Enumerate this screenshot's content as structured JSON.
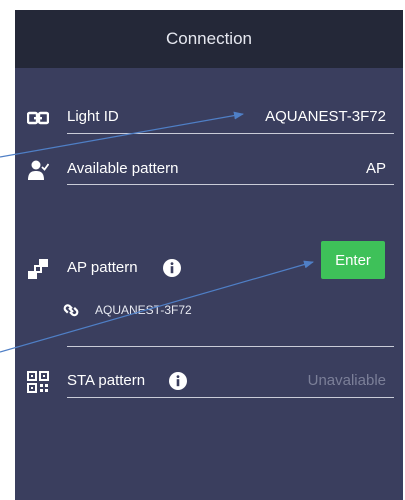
{
  "header": {
    "title": "Connection"
  },
  "rows": {
    "light_id": {
      "label": "Light ID",
      "value": "AQUANEST-3F72"
    },
    "available_pattern": {
      "label": "Available pattern",
      "value": "AP"
    },
    "ap_pattern": {
      "label": "AP pattern",
      "button": "Enter",
      "ssid": "AQUANEST-3F72"
    },
    "sta_pattern": {
      "label": "STA pattern",
      "status": "Unavaliable"
    }
  },
  "colors": {
    "background": "#3a3e5e",
    "header": "#242838",
    "accent_green": "#3ec159",
    "divider": "#c9ccd8",
    "annotation_arrow": "#4f7fc6"
  },
  "icons": [
    "id-card-icon",
    "user-check-icon",
    "ap-network-icon",
    "info-icon",
    "link-icon",
    "qr-scan-icon"
  ]
}
